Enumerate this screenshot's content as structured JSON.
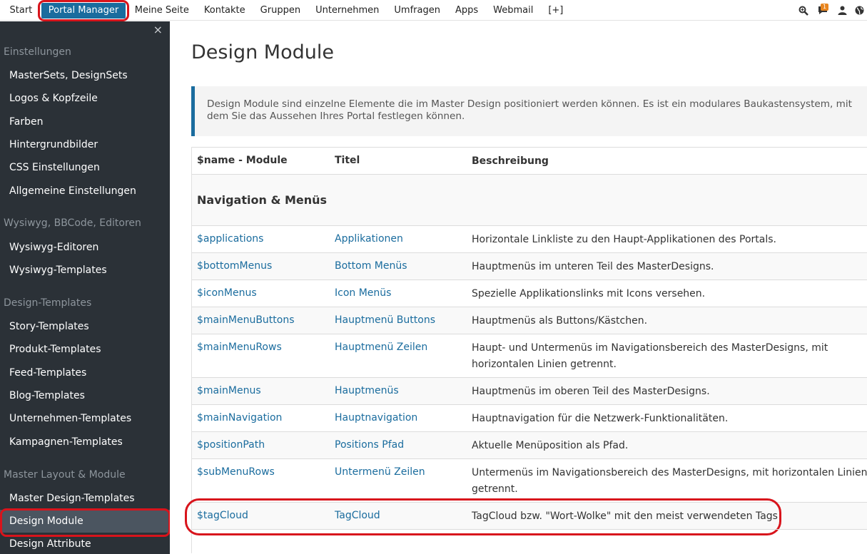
{
  "topbar": {
    "nav": [
      "Start",
      "Portal Manager",
      "Meine Seite",
      "Kontakte",
      "Gruppen",
      "Unternehmen",
      "Umfragen",
      "Apps",
      "Webmail",
      "[+]"
    ],
    "active": "Portal Manager",
    "notification_count": "1",
    "icons": [
      "search-icon",
      "chat-icon",
      "user-icon",
      "globe-icon"
    ]
  },
  "sidebar": {
    "close": "×",
    "sections": [
      {
        "title": "Einstellungen",
        "items": [
          "MasterSets, DesignSets",
          "Logos & Kopfzeile",
          "Farben",
          "Hintergrundbilder",
          "CSS Einstellungen",
          "Allgemeine Einstellungen"
        ]
      },
      {
        "title": "Wysiwyg, BBCode, Editoren",
        "items": [
          "Wysiwyg-Editoren",
          "Wysiwyg-Templates"
        ]
      },
      {
        "title": "Design-Templates",
        "items": [
          "Story-Templates",
          "Produkt-Templates",
          "Feed-Templates",
          "Blog-Templates",
          "Unternehmen-Templates",
          "Kampagnen-Templates"
        ]
      },
      {
        "title": "Master Layout & Module",
        "items": [
          "Master Design-Templates",
          "Design Module",
          "Design Attribute"
        ]
      }
    ],
    "active_item": "Design Module"
  },
  "main": {
    "title": "Design Module",
    "callout": "Design Module sind einzelne Elemente die im Master Design positioniert werden können. Es ist ein modulares Baukastensystem, mit dem Sie das Aussehen Ihres Portal festlegen können.",
    "table": {
      "headers": [
        "$name - Module",
        "Titel",
        "Beschreibung"
      ],
      "group": "Navigation & Menüs",
      "rows": [
        {
          "name": "$applications",
          "title": "Applikationen",
          "desc": "Horizontale Linkliste zu den Haupt-Applikationen des Portals."
        },
        {
          "name": "$bottomMenus",
          "title": "Bottom Menüs",
          "desc": "Hauptmenüs im unteren Teil des MasterDesigns."
        },
        {
          "name": "$iconMenus",
          "title": "Icon Menüs",
          "desc": "Spezielle Applikationslinks mit Icons versehen."
        },
        {
          "name": "$mainMenuButtons",
          "title": "Hauptmenü Buttons",
          "desc": "Hauptmenüs als Buttons/Kästchen."
        },
        {
          "name": "$mainMenuRows",
          "title": "Hauptmenü Zeilen",
          "desc": "Haupt- und Untermenüs im Navigationsbereich des MasterDesigns, mit horizontalen Linien getrennt."
        },
        {
          "name": "$mainMenus",
          "title": "Hauptmenüs",
          "desc": "Hauptmenüs im oberen Teil des MasterDesigns."
        },
        {
          "name": "$mainNavigation",
          "title": "Hauptnavigation",
          "desc": "Hauptnavigation für die Netzwerk-Funktionalitäten."
        },
        {
          "name": "$positionPath",
          "title": "Positions Pfad",
          "desc": "Aktuelle Menüposition als Pfad."
        },
        {
          "name": "$subMenuRows",
          "title": "Untermenü Zeilen",
          "desc": "Untermenüs im Navigationsbereich des MasterDesigns, mit horizontalen Linien getrennt."
        },
        {
          "name": "$tagCloud",
          "title": "TagCloud",
          "desc": "TagCloud bzw. \"Wort-Wolke\" mit den meist verwendeten Tags"
        }
      ],
      "highlighted_row": "$tagCloud"
    }
  }
}
